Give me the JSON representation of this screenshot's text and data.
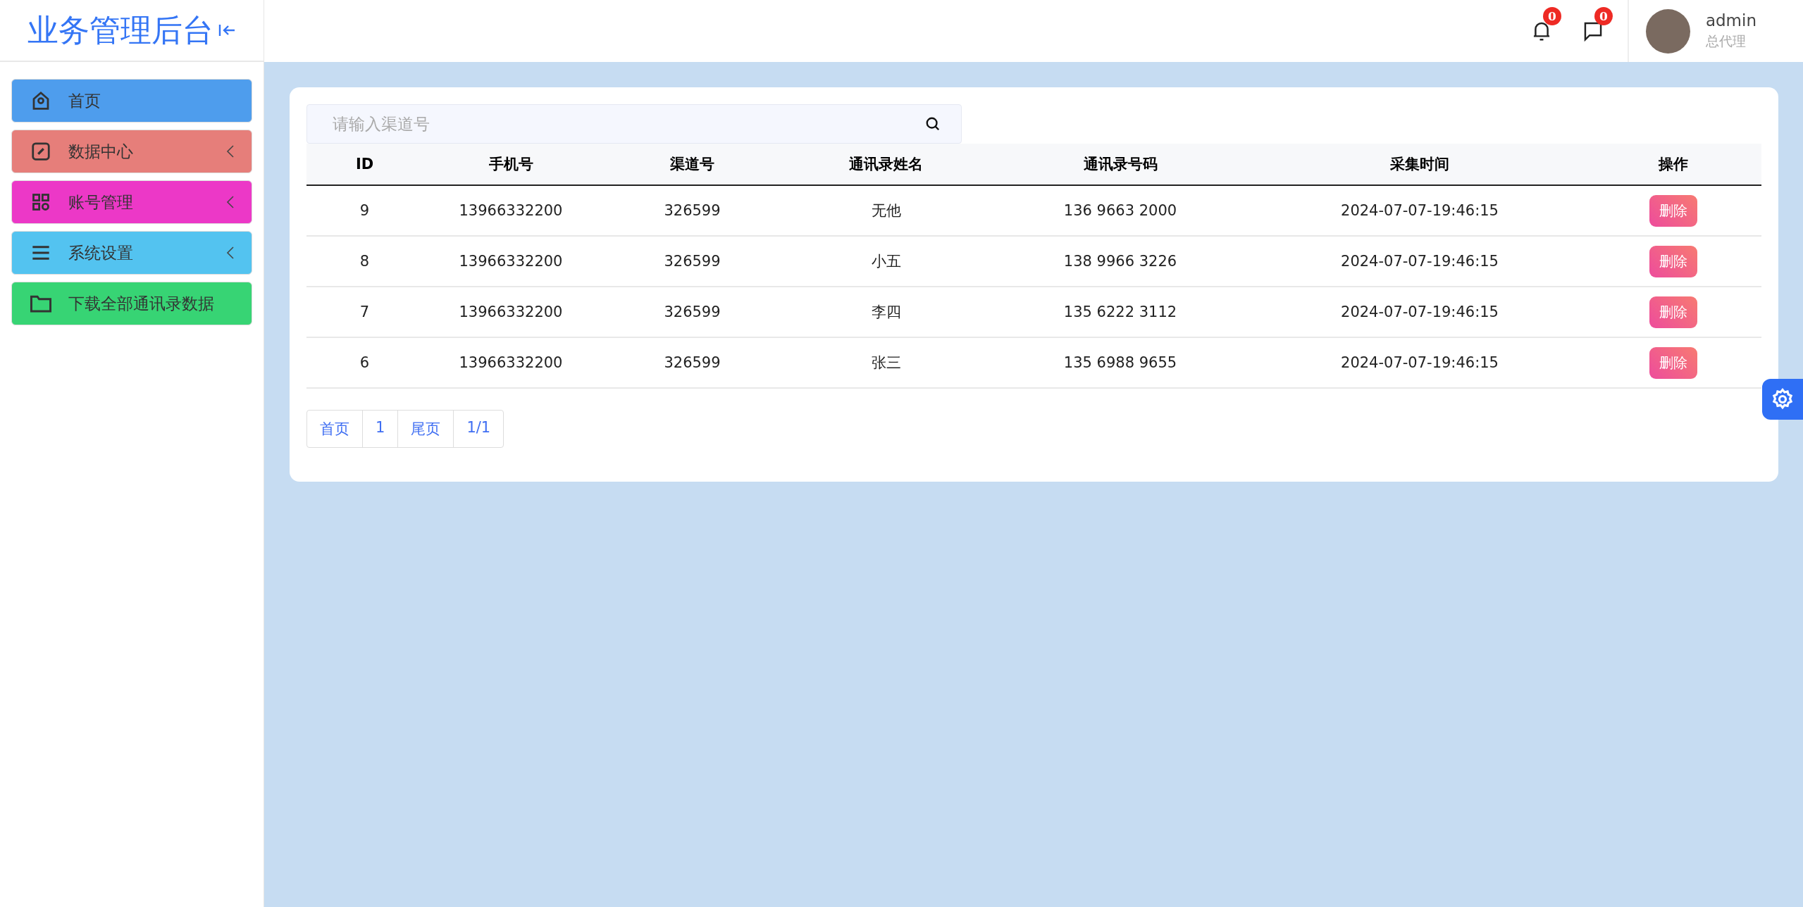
{
  "sidebar": {
    "title": "业务管理后台",
    "items": [
      {
        "label": "首页",
        "color": "#4e9ded",
        "kind": "link"
      },
      {
        "label": "数据中心",
        "color": "#e67e7a",
        "kind": "submenu"
      },
      {
        "label": "账号管理",
        "color": "#ec38c7",
        "kind": "submenu"
      },
      {
        "label": "系统设置",
        "color": "#53c3f0",
        "kind": "submenu"
      },
      {
        "label": "下载全部通讯录数据",
        "color": "#37d474",
        "kind": "link"
      }
    ]
  },
  "header": {
    "notifications": "0",
    "messages": "0",
    "user": {
      "name": "admin",
      "role": "总代理"
    }
  },
  "search": {
    "placeholder": "请输入渠道号"
  },
  "table": {
    "columns": [
      "ID",
      "手机号",
      "渠道号",
      "通讯录姓名",
      "通讯录号码",
      "采集时间",
      "操作"
    ],
    "rows": [
      {
        "cells": [
          "9",
          "13966332200",
          "326599",
          "无他",
          "136 9663 2000",
          "2024-07-07-19:46:15"
        ],
        "action": "删除"
      },
      {
        "cells": [
          "8",
          "13966332200",
          "326599",
          "小五",
          "138 9966 3226",
          "2024-07-07-19:46:15"
        ],
        "action": "删除"
      },
      {
        "cells": [
          "7",
          "13966332200",
          "326599",
          "李四",
          "135 6222 3112",
          "2024-07-07-19:46:15"
        ],
        "action": "删除"
      },
      {
        "cells": [
          "6",
          "13966332200",
          "326599",
          "张三",
          "135 6988 9655",
          "2024-07-07-19:46:15"
        ],
        "action": "删除"
      }
    ]
  },
  "pagination": [
    "首页",
    "1",
    "尾页",
    "1/1"
  ]
}
